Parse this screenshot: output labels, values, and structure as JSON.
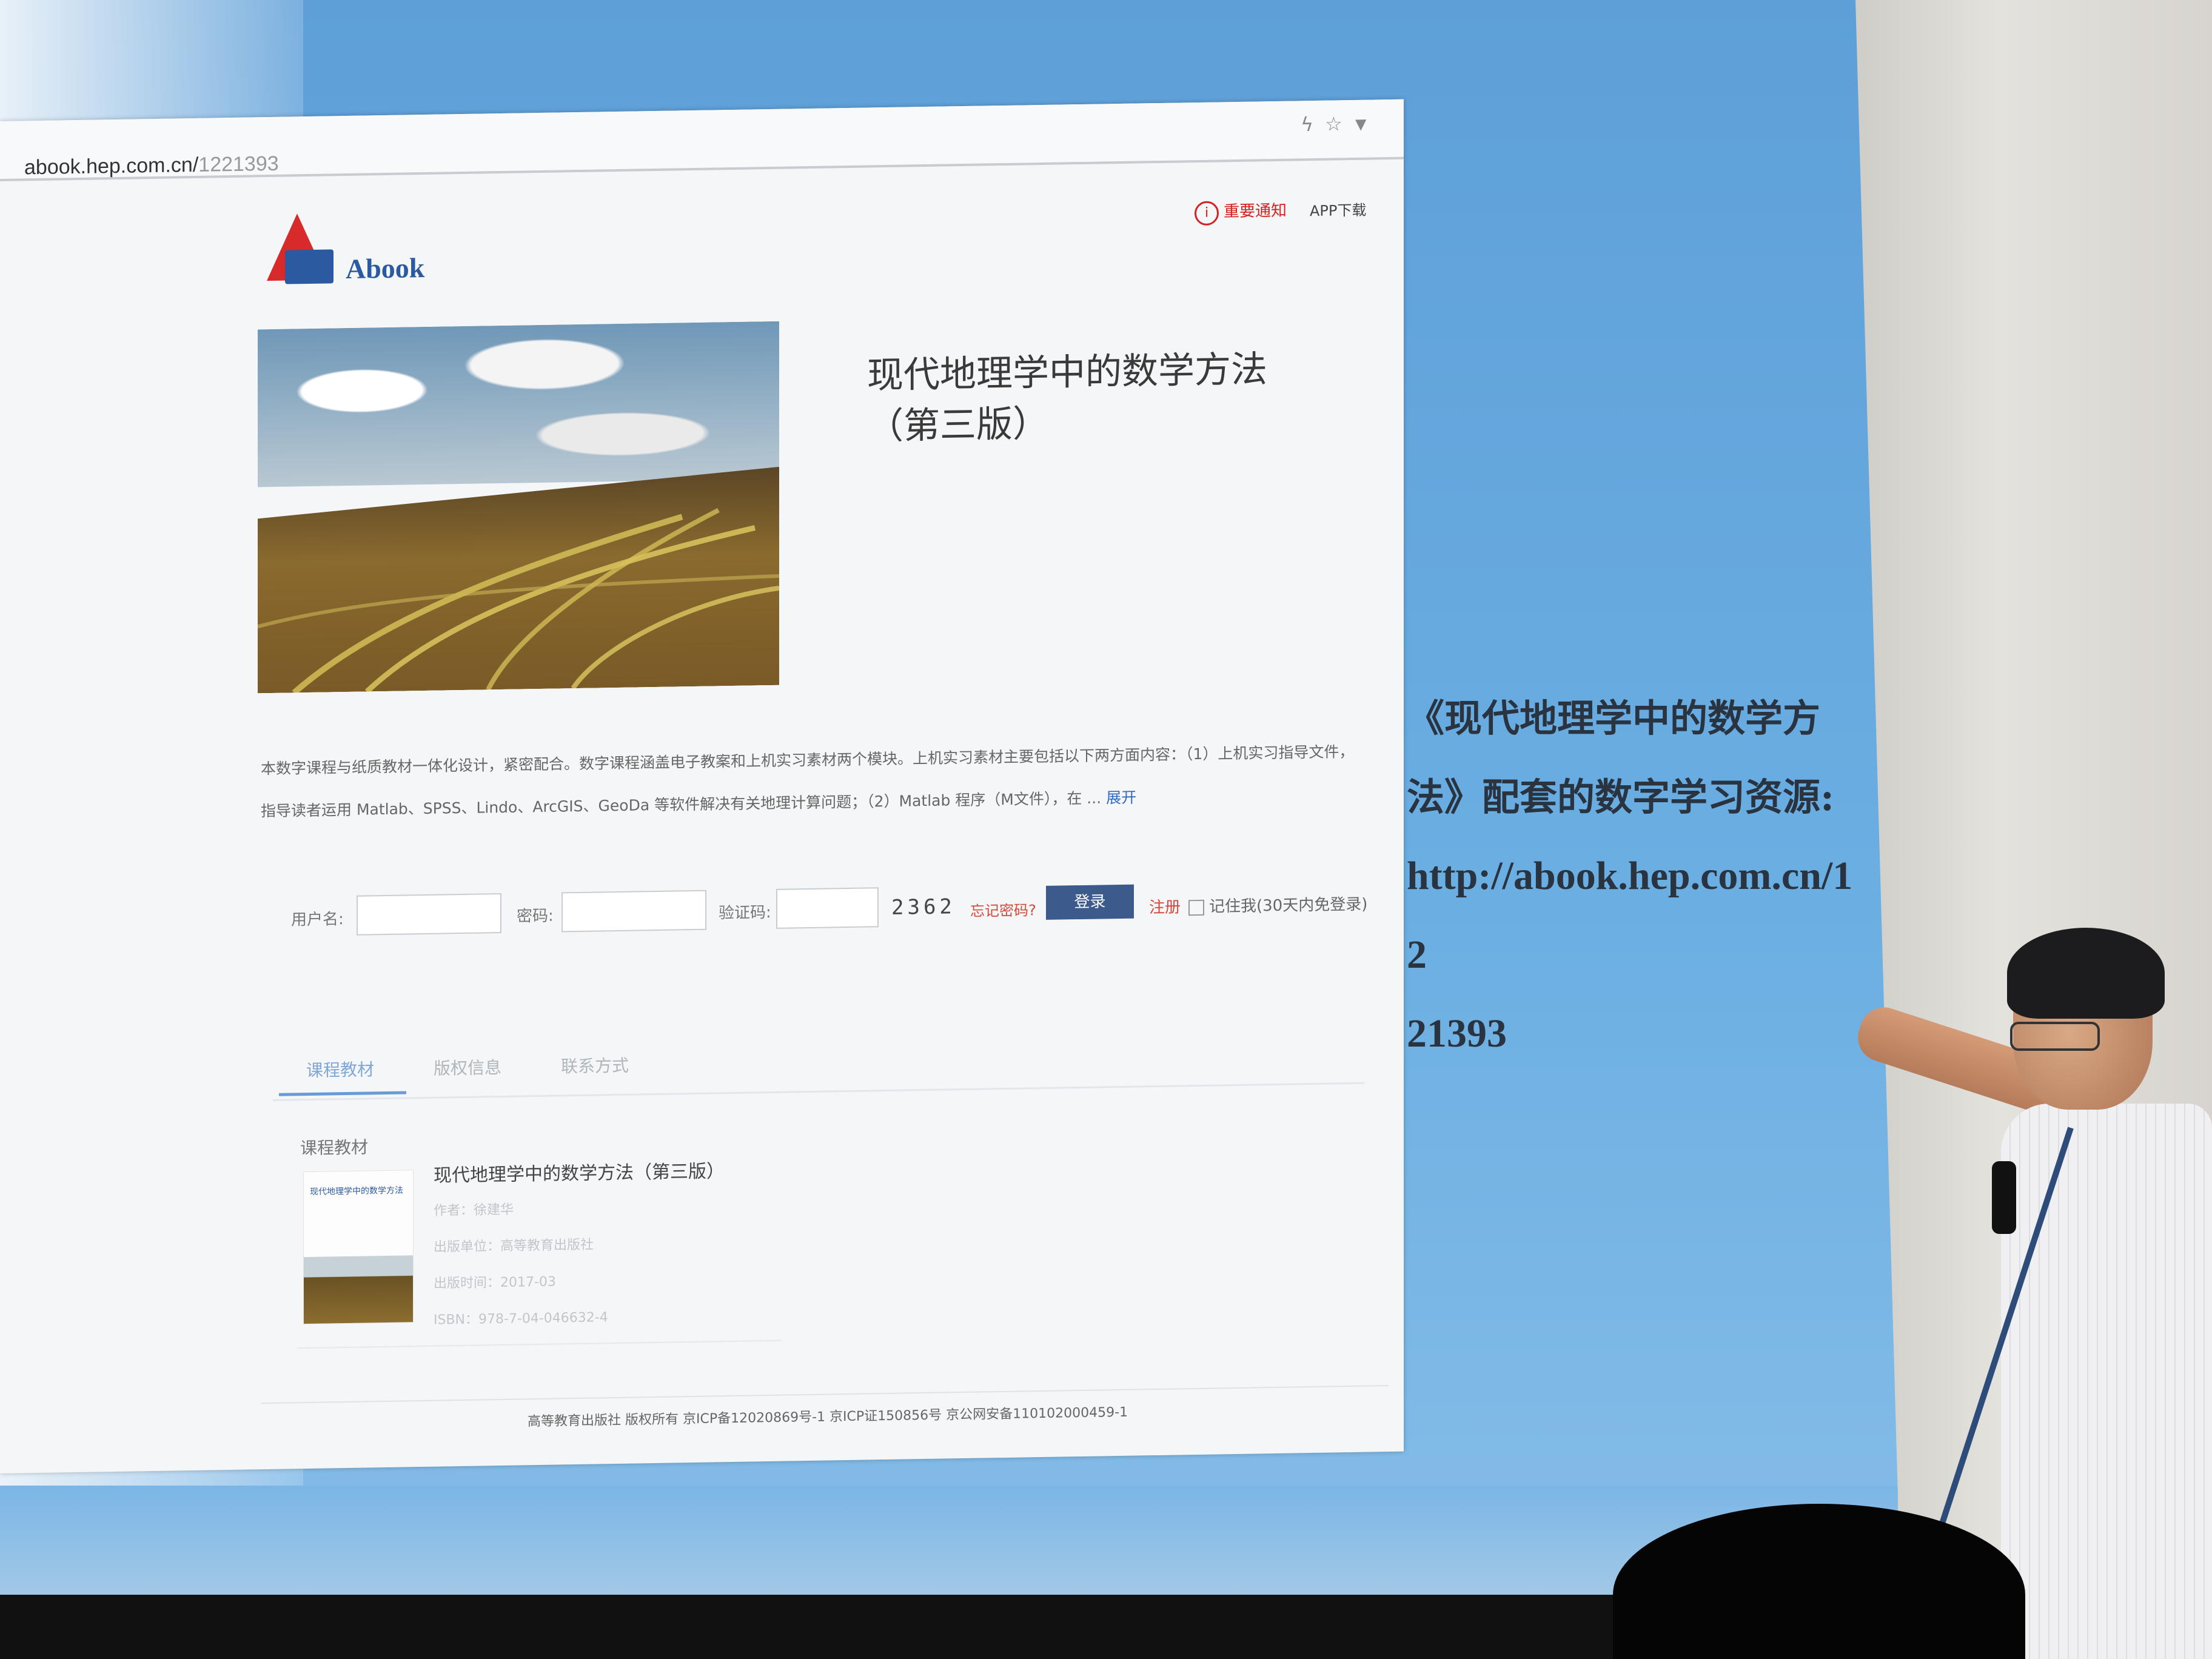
{
  "browser": {
    "address_host": "abook.hep.com.cn/",
    "address_path": "1221393",
    "toolbar_icons": [
      "flash-icon",
      "star-icon",
      "chevron-down-icon"
    ]
  },
  "site": {
    "logo_text": "Abook",
    "notice_label": "重要通知",
    "app_download_label": "APP下载"
  },
  "book": {
    "title": "现代地理学中的数学方法（第三版）",
    "intro": "本数字课程与纸质教材一体化设计，紧密配合。数字课程涵盖电子教案和上机实习素材两个模块。上机实习素材主要包括以下两方面内容：（1）上机实习指导文件，指导读者运用 Matlab、SPSS、Lindo、ArcGIS、GeoDa 等软件解决有关地理计算问题；（2）Matlab 程序（M文件），在 ...",
    "intro_more": "展开"
  },
  "login": {
    "username_label": "用户名:",
    "password_label": "密码:",
    "captcha_label": "验证码:",
    "captcha_value": "2362",
    "forgot_label": "忘记密码?",
    "login_button": "登录",
    "register_label": "注册",
    "remember_label": "记住我(30天内免登录)"
  },
  "tabs": [
    {
      "label": "课程教材",
      "active": true
    },
    {
      "label": "版权信息",
      "active": false
    },
    {
      "label": "联系方式",
      "active": false
    }
  ],
  "course": {
    "section_label": "课程教材",
    "item_title": "现代地理学中的数学方法（第三版）",
    "author": "作者：徐建华",
    "publisher": "出版单位：高等教育出版社",
    "pub_date": "出版时间：2017-03",
    "isbn": "ISBN：978-7-04-046632-4",
    "thumb_title": "现代地理学中的数学方法"
  },
  "footer": {
    "text": "高等教育出版社 版权所有 京ICP备12020869号-1 京ICP证150856号 京公网安备110102000459-1"
  },
  "slide": {
    "line1": "《现代地理学中的数学方",
    "line2": "法》配套的数字学习资源:",
    "url_part1": "http://abook.hep.com.cn/12",
    "url_part2": "21393"
  },
  "colors": {
    "screen_blue": "#6aaee2",
    "brand_red": "#d82a2a",
    "brand_blue": "#2c5aa0",
    "login_button": "#3c5a8c",
    "link_red": "#d24a3a",
    "link_blue": "#2f6bc8"
  }
}
